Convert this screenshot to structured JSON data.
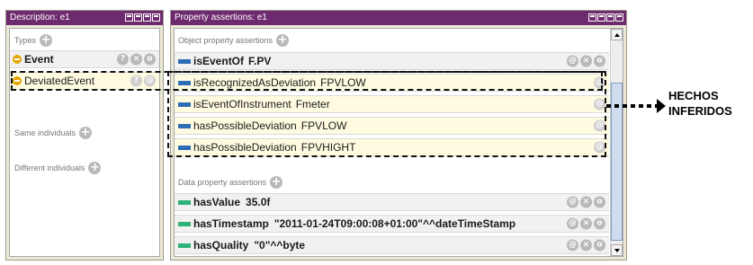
{
  "description_panel": {
    "title": "Description: e1",
    "types_label": "Types",
    "types": [
      {
        "name": "Event",
        "bold": true,
        "actions": [
          "?",
          "×",
          "o"
        ]
      },
      {
        "name": "DeviatedEvent",
        "bold": false,
        "actions": [
          "?",
          "@"
        ]
      }
    ],
    "same_individuals_label": "Same individuals",
    "different_individuals_label": "Different individuals"
  },
  "property_panel": {
    "title": "Property assertions: e1",
    "object_section_label": "Object property assertions",
    "object_assertions": [
      {
        "property": "isEventOf",
        "value": "F.PV",
        "inferred": false,
        "actions": [
          "@",
          "×",
          "o"
        ]
      },
      {
        "property": "isRecognizedAsDeviation",
        "value": "FPVLOW",
        "inferred": true,
        "actions": [
          "@"
        ]
      },
      {
        "property": "isEventOfInstrument",
        "value": "Fmeter",
        "inferred": true,
        "actions": [
          "@"
        ]
      },
      {
        "property": "hasPossibleDeviation",
        "value": "FPVLOW",
        "inferred": true,
        "actions": [
          "@"
        ]
      },
      {
        "property": "hasPossibleDeviation",
        "value": "FPVHIGHT",
        "inferred": true,
        "actions": [
          "@"
        ]
      }
    ],
    "data_section_label": "Data property assertions",
    "data_assertions": [
      {
        "property": "hasValue",
        "value": "35.0f",
        "actions": [
          "@",
          "×",
          "o"
        ]
      },
      {
        "property": "hasTimestamp",
        "value": "\"2011-01-24T09:00:08+01:00\"^^dateTimeStamp",
        "actions": [
          "@",
          "×",
          "o"
        ]
      },
      {
        "property": "hasQuality",
        "value": "\"0\"^^byte",
        "actions": [
          "@",
          "×",
          "o"
        ]
      }
    ]
  },
  "annotation": {
    "line1": "HECHOS",
    "line2": "INFERIDOS"
  },
  "colors": {
    "header": "#6e2a6e",
    "object_property": "#2e6db5",
    "data_property": "#2db37a",
    "individual": "#e5a500",
    "inferred_row": "#fffbe0"
  }
}
